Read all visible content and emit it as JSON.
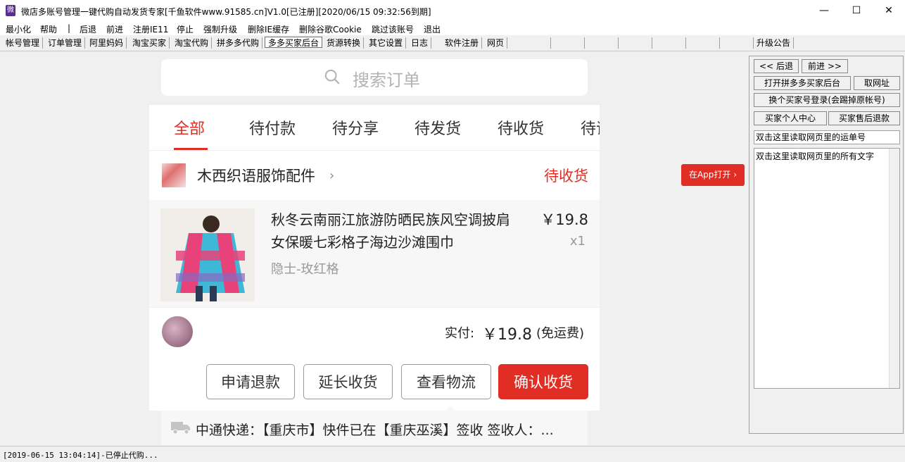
{
  "window": {
    "title": "微店多账号管理一键代购自动发货专家[千鱼软件www.91585.cn]V1.0[已注册][2020/06/15 09:32:56到期]",
    "minimize": "—",
    "maximize": "☐",
    "close": "✕"
  },
  "menu": [
    "最小化",
    "帮助",
    "|",
    "后退",
    "前进",
    "注册IE11",
    "停止",
    "强制升级",
    "删除IE缓存",
    "删除谷歌Cookie",
    "跳过该账号",
    "退出"
  ],
  "tabs": [
    "帐号管理",
    "订单管理",
    "阿里妈妈",
    "淘宝买家",
    "淘宝代购",
    "拼多多代购",
    "多多买家后台",
    "货源转换",
    "其它设置",
    "日志",
    "软件注册",
    "网页",
    "",
    "",
    "",
    "",
    "",
    "",
    "",
    "升级公告"
  ],
  "active_tab": "多多买家后台",
  "page": {
    "search_placeholder": "搜索订单",
    "order_tabs": [
      "全部",
      "待付款",
      "待分享",
      "待发货",
      "待收货",
      "待评价"
    ],
    "shop_name": "木西织语服饰配件",
    "shop_status": "待收货",
    "item_title": "秋冬云南丽江旅游防晒民族风空调披肩女保暖七彩格子海边沙滩围巾",
    "item_spec": "隐士-玫红格",
    "item_price": "￥19.8",
    "item_qty": "x1",
    "pay_label": "实付:",
    "pay_amount": "￥19.8",
    "pay_shipping": "(免运费)",
    "actions": [
      "申请退款",
      "延长收货",
      "查看物流",
      "确认收货"
    ],
    "logistics": "中通快递：【重庆市】快件已在【重庆巫溪】签收 签收人：...",
    "open_in_app": "在App打开"
  },
  "right_panel": {
    "back": "<< 后退",
    "forward": "前进 >>",
    "open_backend": "打开拼多多买家后台",
    "get_url": "取网址",
    "switch_account": "换个买家号登录(会踢掉原帐号)",
    "personal_center": "买家个人中心",
    "after_sale": "买家售后退款",
    "tracking_hint": "双击这里读取网页里的运单号",
    "text_hint": "双击这里读取网页里的所有文字"
  },
  "status": "[2019-06-15 13:04:14]-已停止代购..."
}
